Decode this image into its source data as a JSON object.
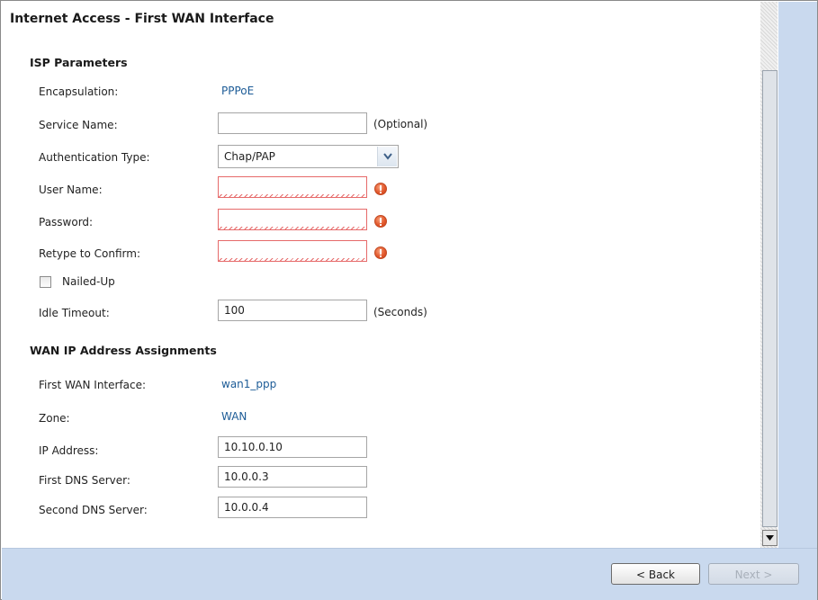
{
  "title": "Internet Access - First WAN Interface",
  "isp": {
    "heading": "ISP Parameters",
    "encapsulation_label": "Encapsulation:",
    "encapsulation_value": "PPPoE",
    "service_name_label": "Service Name:",
    "service_name_value": "",
    "service_name_hint": "(Optional)",
    "auth_type_label": "Authentication Type:",
    "auth_type_value": "Chap/PAP",
    "user_name_label": "User Name:",
    "user_name_value": "",
    "password_label": "Password:",
    "password_value": "",
    "retype_label": "Retype to Confirm:",
    "retype_value": "",
    "nailed_up_label": "Nailed-Up",
    "nailed_up_checked": false,
    "idle_timeout_label": "Idle Timeout:",
    "idle_timeout_value": "100",
    "idle_timeout_hint": "(Seconds)"
  },
  "wan": {
    "heading": "WAN IP Address Assignments",
    "first_wan_label": "First WAN Interface:",
    "first_wan_value": "wan1_ppp",
    "zone_label": "Zone:",
    "zone_value": "WAN",
    "ip_label": "IP Address:",
    "ip_value": "10.10.0.10",
    "dns1_label": "First DNS Server:",
    "dns1_value": "10.0.0.3",
    "dns2_label": "Second DNS Server:",
    "dns2_value": "10.0.0.4"
  },
  "buttons": {
    "back_label": "< Back",
    "next_label": "Next >"
  },
  "colors": {
    "value_link": "#1d5c97",
    "panel_blue": "#c9d9ee",
    "error_border": "#e66a6a",
    "error_icon": "#e2582c"
  }
}
